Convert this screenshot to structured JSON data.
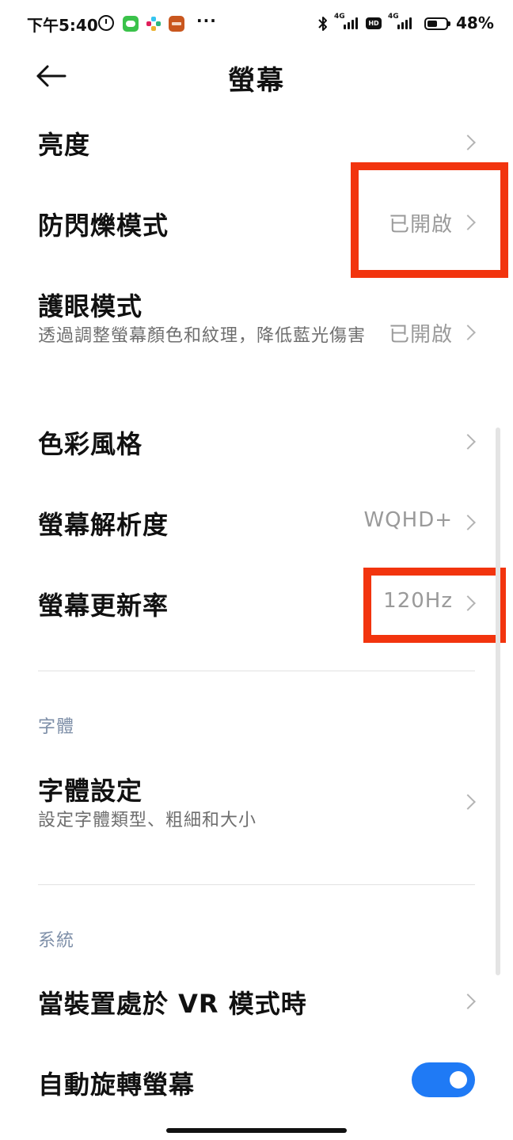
{
  "status_bar": {
    "time": "下午5:40",
    "more": "···",
    "network_1": "4G",
    "network_2": "4G",
    "hd": "HD",
    "battery": "48%",
    "icons": [
      "alarm-icon",
      "line-icon",
      "slack-icon",
      "app-icon",
      "bluetooth-icon",
      "signal-icon",
      "battery-icon"
    ],
    "colors": {
      "line": "#3ac24a",
      "app": "#c9571e"
    }
  },
  "header": {
    "title": "螢幕",
    "back_icon": "arrow-left-icon"
  },
  "items": {
    "brightness": {
      "title": "亮度"
    },
    "flicker": {
      "title": "防閃爍模式",
      "value": "已開啟"
    },
    "eye_care": {
      "title": "護眼模式",
      "subtitle": "透過調整螢幕顏色和紋理，降低藍光傷害",
      "value": "已開啟"
    },
    "color_style": {
      "title": "色彩風格"
    },
    "resolution": {
      "title": "螢幕解析度",
      "value": "WQHD+"
    },
    "refresh_rate": {
      "title": "螢幕更新率",
      "value": "120Hz"
    },
    "font_settings": {
      "title": "字體設定",
      "subtitle": "設定字體類型、粗細和大小"
    },
    "vr_mode": {
      "title": "當裝置處於 VR 模式時"
    },
    "auto_rotate": {
      "title": "自動旋轉螢幕",
      "enabled": true
    }
  },
  "sections": {
    "font": "字體",
    "system": "系統"
  },
  "colors": {
    "highlight": "#f2340e",
    "toggle_on": "#1f7af5",
    "section_label": "#7e8fa8",
    "value_text": "#9a9a9a"
  }
}
